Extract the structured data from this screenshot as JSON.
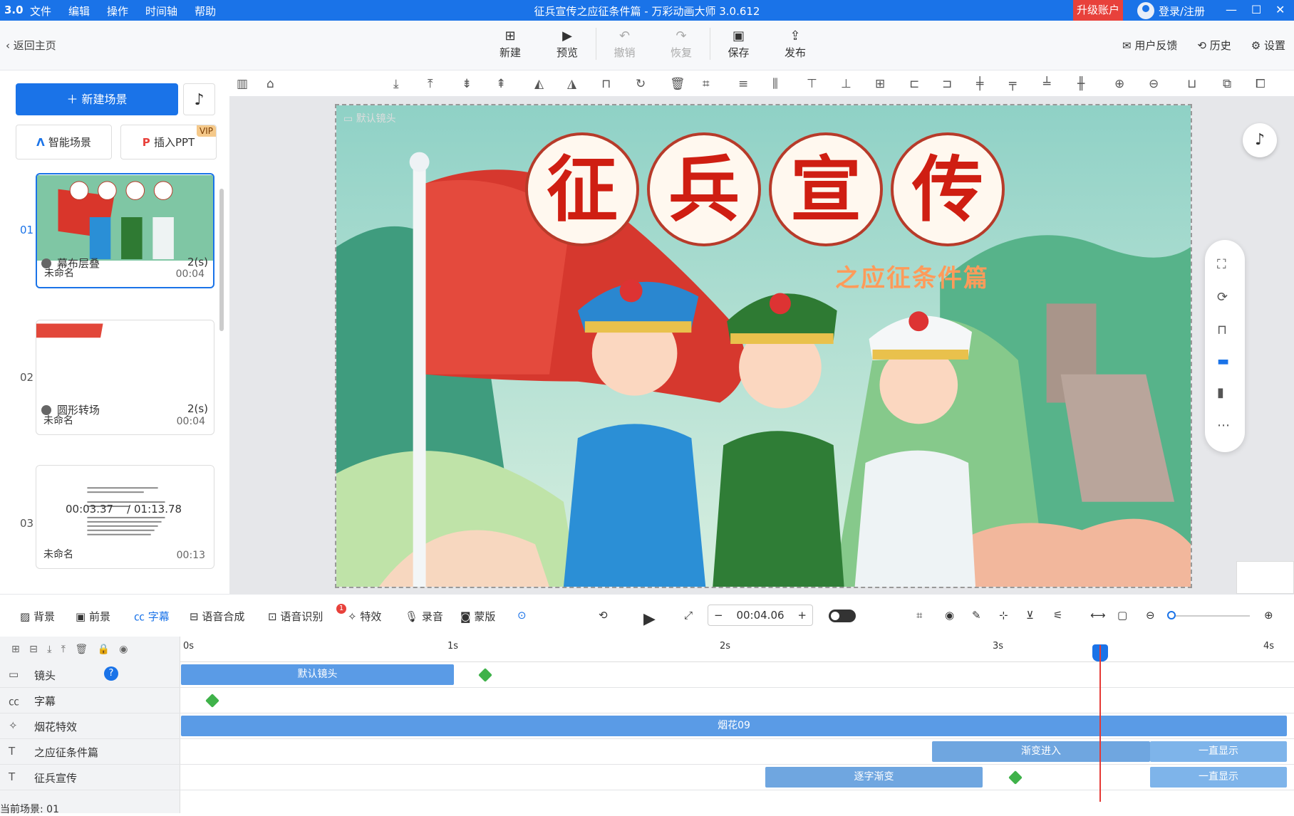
{
  "titlebar": {
    "logo": "3.0",
    "menu": [
      "文件",
      "编辑",
      "操作",
      "时间轴",
      "帮助"
    ],
    "title": "征兵宣传之应征条件篇 - 万彩动画大师 3.0.612",
    "upgrade": "升级账户",
    "login": "登录/注册"
  },
  "toolbar": {
    "back": "返回主页",
    "buttons": [
      {
        "label": "新建",
        "icon": "plus-icon"
      },
      {
        "label": "预览",
        "icon": "play-icon"
      },
      {
        "label": "撤销",
        "icon": "undo-icon"
      },
      {
        "label": "恢复",
        "icon": "redo-icon"
      },
      {
        "label": "保存",
        "icon": "save-icon"
      },
      {
        "label": "发布",
        "icon": "publish-icon"
      }
    ],
    "right": [
      "用户反馈",
      "历史",
      "设置"
    ]
  },
  "left": {
    "new_scene": "新建场景",
    "smart": "智能场景",
    "ppt": "插入PPT",
    "vip": "VIP",
    "scenes": [
      {
        "num": "01",
        "name": "未命名",
        "dur": "00:04"
      },
      {
        "num": "02",
        "name": "未命名",
        "dur": "00:04"
      },
      {
        "num": "03",
        "name": "未命名",
        "dur": "00:13"
      }
    ],
    "transitions": [
      {
        "name": "幕布层叠",
        "dur": "2(s)"
      },
      {
        "name": "圆形转场",
        "dur": "2(s)"
      }
    ],
    "time_current": "00:03.37",
    "time_total": "/ 01:13.78"
  },
  "stage": {
    "camera_label": "默认镜头",
    "title_chars": [
      "征",
      "兵",
      "宣",
      "传"
    ],
    "subtitle": "之应征条件篇"
  },
  "timeline": {
    "tabs": [
      "背景",
      "前景",
      "字幕",
      "语音合成",
      "语音识别",
      "特效",
      "录音",
      "蒙版"
    ],
    "badge": "1",
    "time": "00:04.06",
    "ruler": [
      "0s",
      "1s",
      "2s",
      "3s",
      "4s"
    ],
    "tracks": [
      {
        "label": "镜头",
        "clips": [
          "默认镜头"
        ]
      },
      {
        "label": "字幕",
        "clips": []
      },
      {
        "label": "烟花特效",
        "clips": [
          "烟花09"
        ]
      },
      {
        "label": "之应征条件篇",
        "clips": [
          "渐变进入",
          "一直显示"
        ]
      },
      {
        "label": "征兵宣传",
        "clips": [
          "逐字渐变",
          "一直显示"
        ]
      }
    ],
    "current_scene": "当前场景: 01"
  }
}
